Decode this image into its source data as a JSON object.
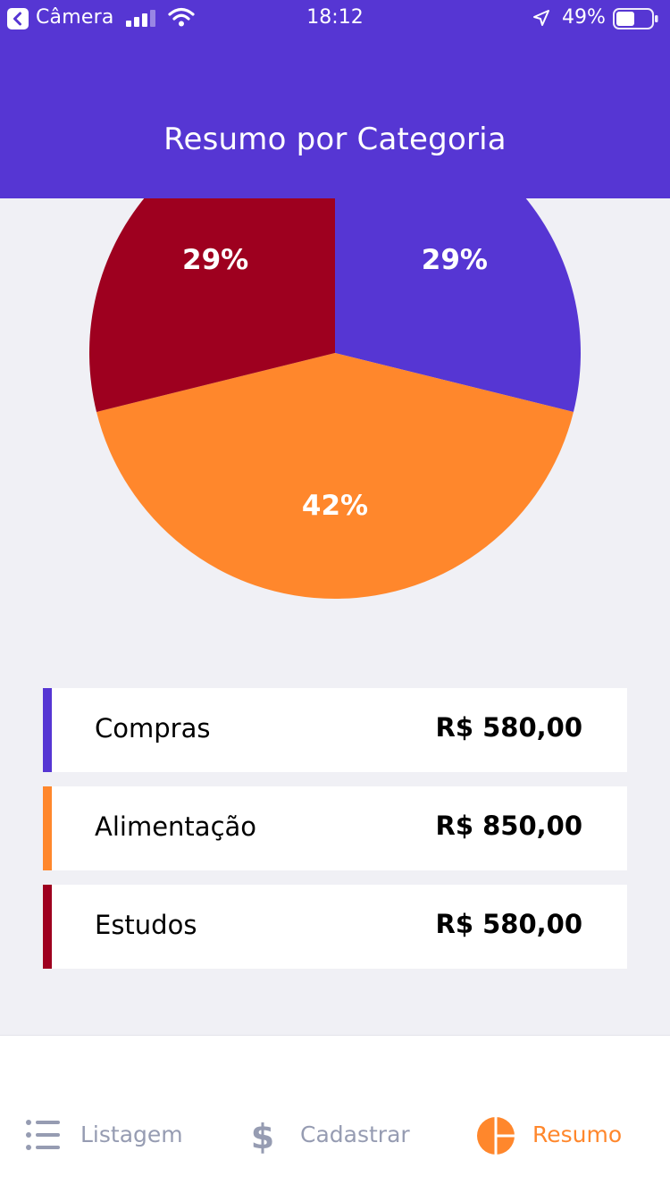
{
  "status_bar": {
    "back_app": "Câmera",
    "time": "18:12",
    "battery": "49%"
  },
  "header": {
    "title": "Resumo por Categoria"
  },
  "colors": {
    "primary": "#5636d3",
    "orange": "#ff872c",
    "red": "#9e001f",
    "background": "#f0f0f5",
    "tab_inactive": "#969cb2"
  },
  "chart_data": {
    "type": "pie",
    "title": "",
    "slices": [
      {
        "name": "Compras",
        "value": 580,
        "percent": 29,
        "label": "29%",
        "color": "#5636d3"
      },
      {
        "name": "Alimentação",
        "value": 850,
        "percent": 42,
        "label": "42%",
        "color": "#ff872c"
      },
      {
        "name": "Estudos",
        "value": 580,
        "percent": 29,
        "label": "29%",
        "color": "#9e001f"
      }
    ]
  },
  "legend": [
    {
      "name": "Compras",
      "amount": "R$ 580,00",
      "color": "#5636d3"
    },
    {
      "name": "Alimentação",
      "amount": "R$ 850,00",
      "color": "#ff872c"
    },
    {
      "name": "Estudos",
      "amount": "R$ 580,00",
      "color": "#9e001f"
    }
  ],
  "tabs": [
    {
      "label": "Listagem",
      "icon": "list-icon",
      "active": false
    },
    {
      "label": "Cadastrar",
      "icon": "dollar-sign-icon",
      "active": false
    },
    {
      "label": "Resumo",
      "icon": "pie-chart-icon",
      "active": true
    }
  ]
}
